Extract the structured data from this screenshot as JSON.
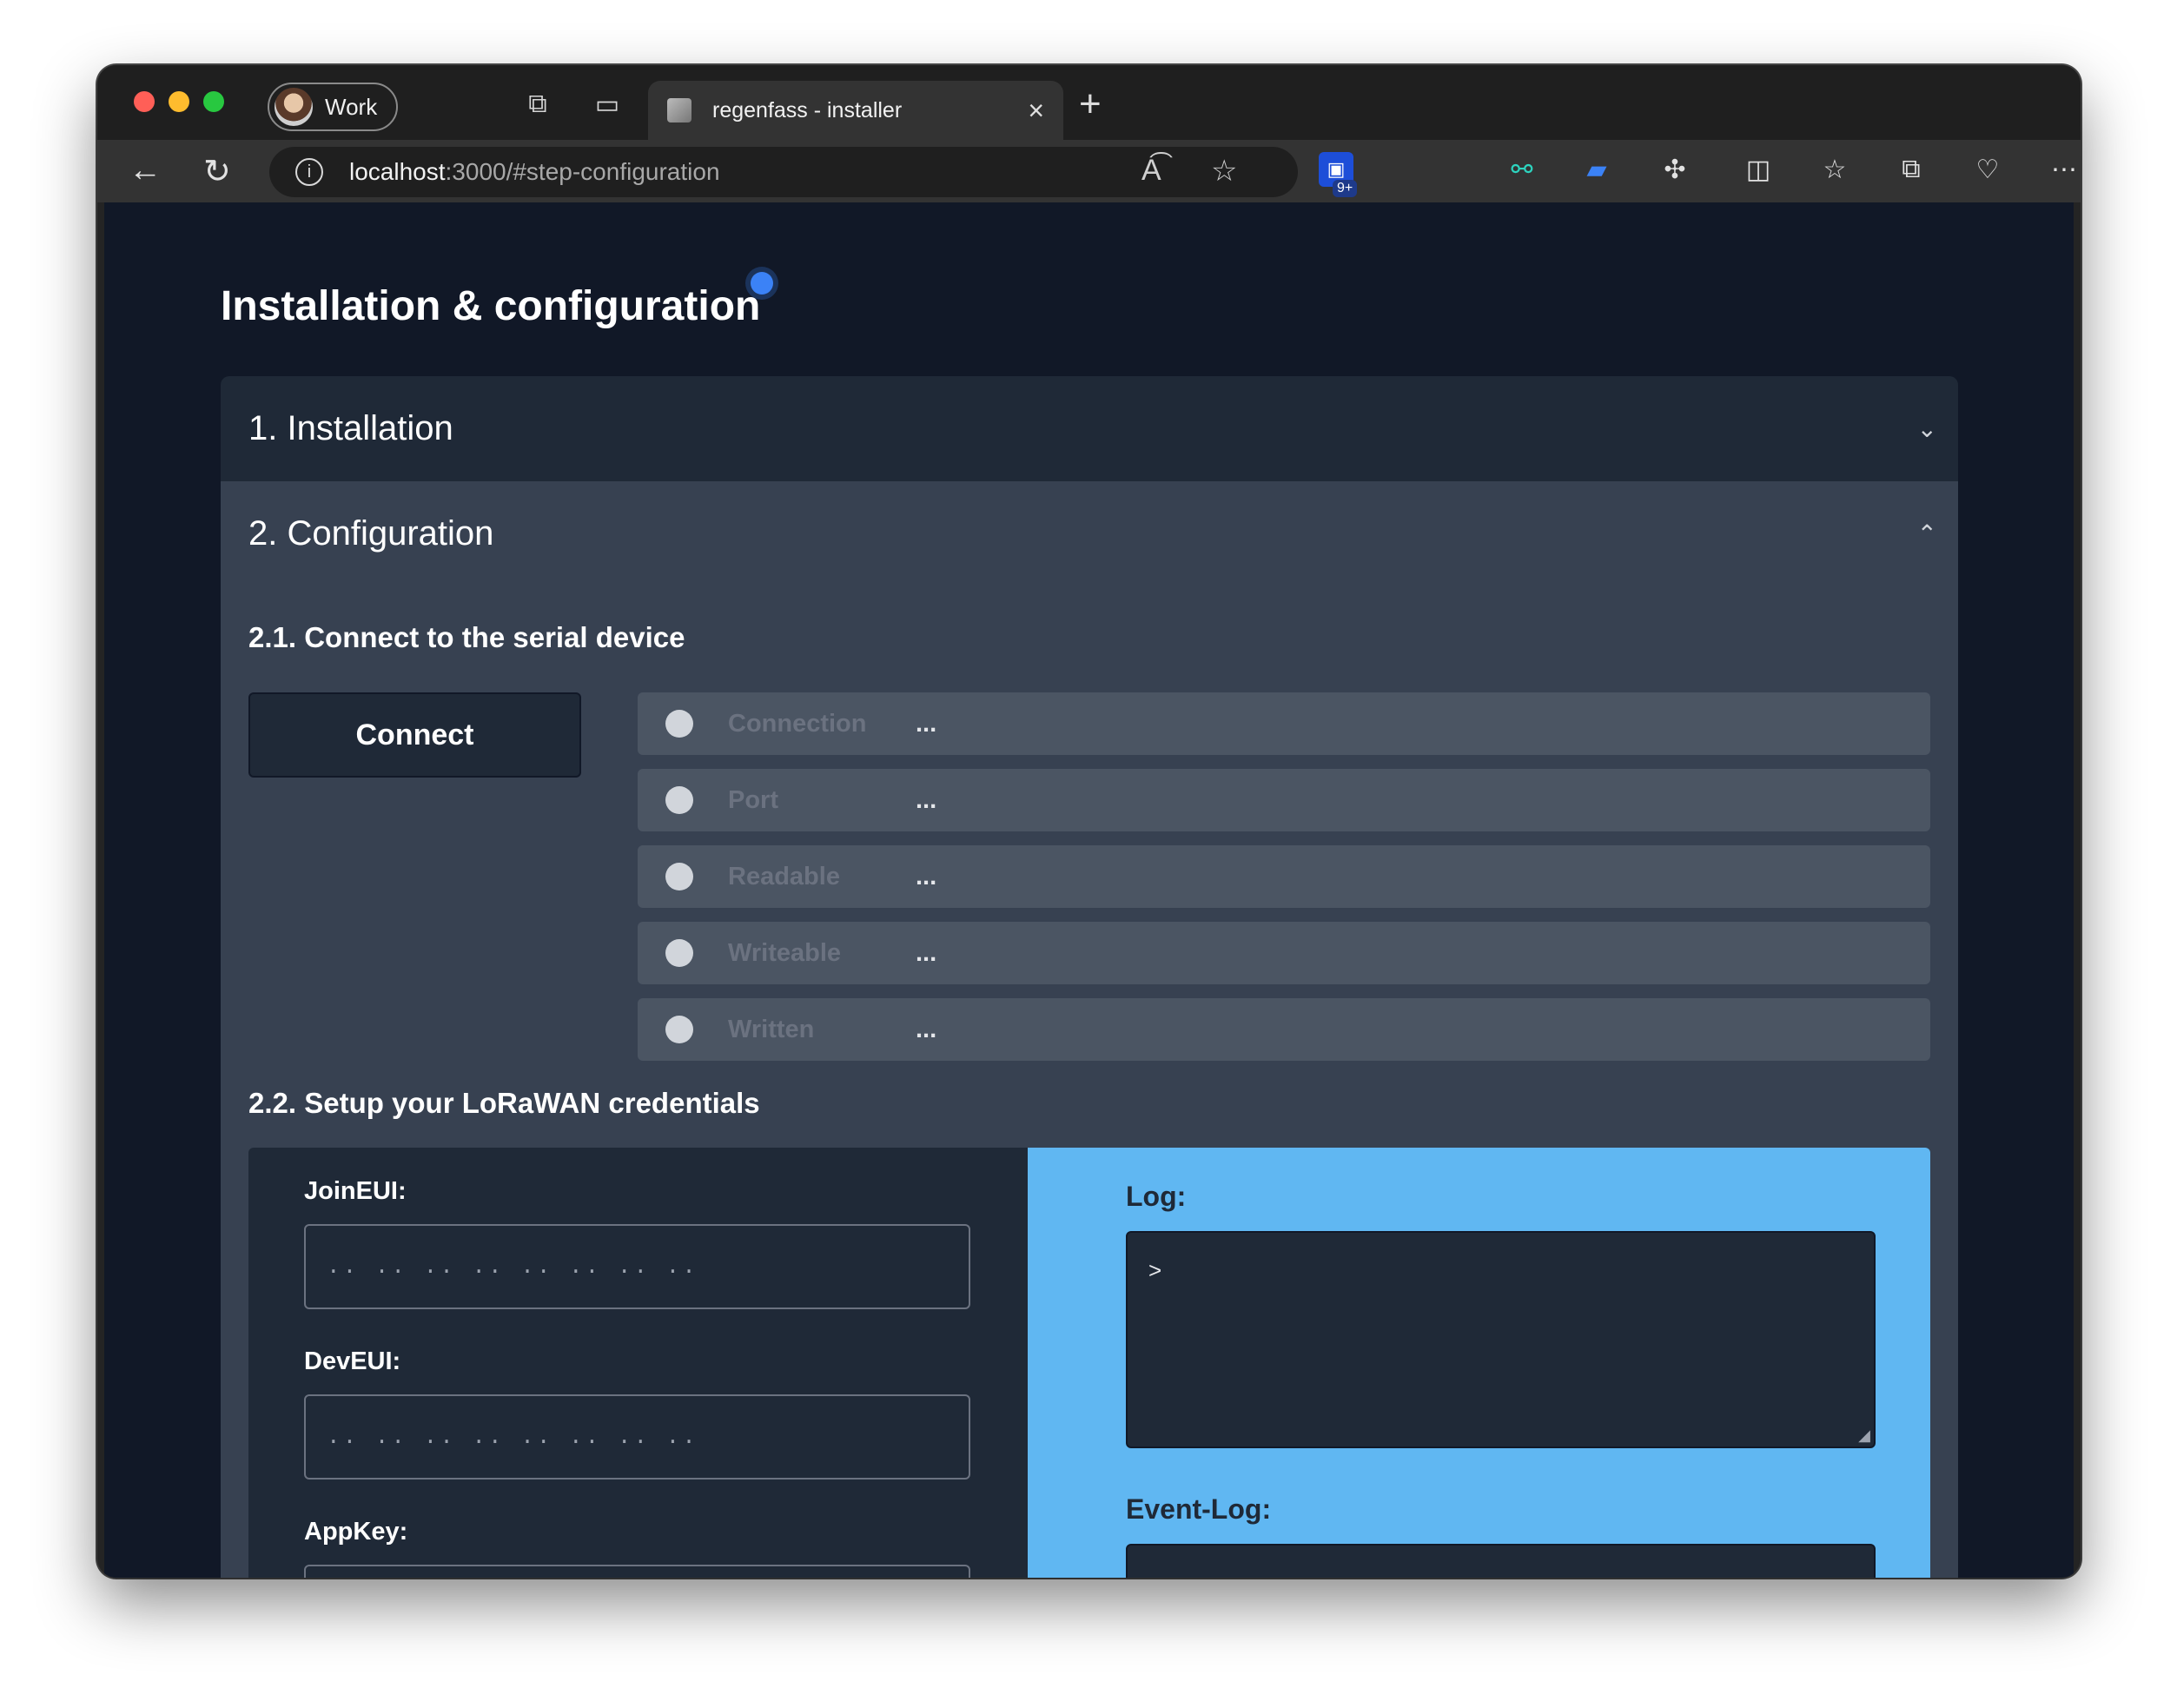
{
  "browser": {
    "profile_label": "Work",
    "tab_title": "regenfass - installer",
    "url_host": "localhost",
    "url_rest": ":3000/#step-configuration",
    "extension_badge": "9+"
  },
  "page": {
    "title": "Installation & configuration",
    "sections": {
      "installation": {
        "label": "1. Installation"
      },
      "configuration": {
        "label": "2. Configuration"
      }
    },
    "serial": {
      "heading": "2.1. Connect to the serial device",
      "connect_label": "Connect",
      "statuses": [
        {
          "label": "Connection",
          "value": "..."
        },
        {
          "label": "Port",
          "value": "..."
        },
        {
          "label": "Readable",
          "value": "..."
        },
        {
          "label": "Writeable",
          "value": "..."
        },
        {
          "label": "Written",
          "value": "..."
        }
      ]
    },
    "lorawan": {
      "heading": "2.2. Setup your LoRaWAN credentials",
      "join_eui": {
        "label": "JoinEUI:",
        "placeholder": ".. .. .. .. .. .. .. .."
      },
      "dev_eui": {
        "label": "DevEUI:",
        "placeholder": ".. .. .. .. .. .. .. .."
      },
      "app_key": {
        "label": "AppKey:"
      },
      "log": {
        "label": "Log:",
        "value": ">"
      },
      "event_log": {
        "label": "Event-Log:"
      }
    }
  },
  "colors": {
    "page_bg": "#111827",
    "panel": "#1f2937",
    "open_section": "#374151",
    "status_row": "#4b5563",
    "log_panel": "#60b7f2",
    "accent_dot": "#3b82f6"
  }
}
